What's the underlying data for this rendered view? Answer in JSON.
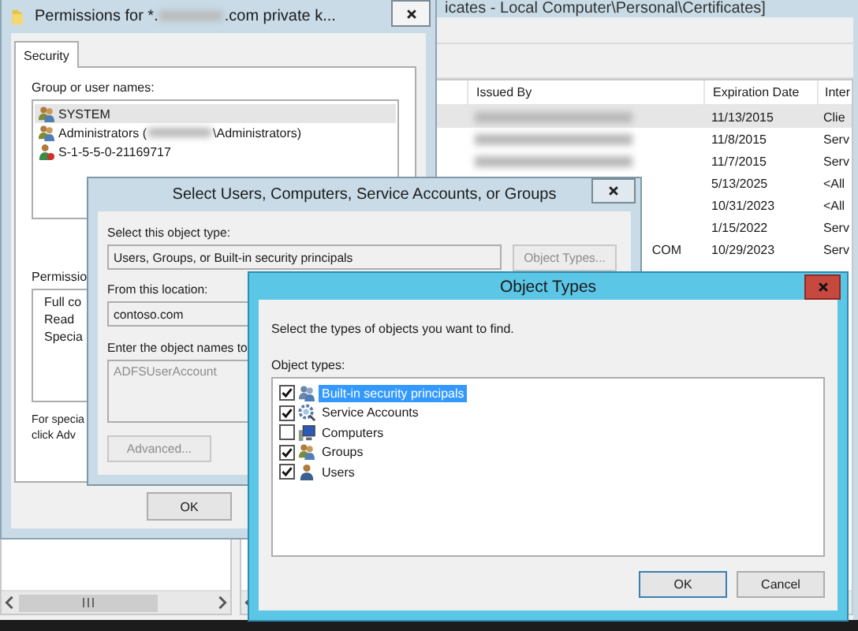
{
  "certificates_window": {
    "title": "icates - Local Computer\\Personal\\Certificates]",
    "columns": [
      "Issued By",
      "Expiration Date",
      "Inter"
    ],
    "rows": [
      {
        "issued_by_redacted": true,
        "expiration_date": "11/13/2015",
        "intended": "Clie",
        "selected": true
      },
      {
        "issued_by_redacted": true,
        "expiration_date": "11/8/2015",
        "intended": "Serv",
        "selected": false
      },
      {
        "issued_by_redacted": true,
        "expiration_date": "11/7/2015",
        "intended": "Serv",
        "selected": false
      },
      {
        "issued_by_redacted": false,
        "expiration_date": "5/13/2025",
        "intended": "<All",
        "selected": false
      },
      {
        "issued_by_redacted": false,
        "expiration_date": "10/31/2023",
        "intended": "<All",
        "selected": false
      },
      {
        "issued_by_redacted": false,
        "expiration_date": "1/15/2022",
        "intended": "Serv",
        "selected": false
      },
      {
        "issued_by_redacted": false,
        "issued_by": "COM",
        "expiration_date": "10/29/2023",
        "intended": "Serv",
        "selected": false
      }
    ]
  },
  "permissions_window": {
    "title_start": "Permissions for *.",
    "title_end": ".com private k...",
    "tabs": [
      {
        "label": "Security",
        "selected": true
      }
    ],
    "users_label": "Group or user names:",
    "users": [
      {
        "kind": "group",
        "name": "SYSTEM",
        "selected": true
      },
      {
        "kind": "group",
        "name": "Administrators (",
        "name_end": "\\Administrators)",
        "selected": false
      },
      {
        "kind": "unknown",
        "name": "S-1-5-5-0-21169717",
        "selected": false
      }
    ],
    "permissions_label": "Permissio",
    "permissions": [
      "Full co",
      "Read",
      "Specia"
    ],
    "note_lines": [
      "For specia",
      "click Adv"
    ],
    "buttons": [
      "OK"
    ]
  },
  "select_dialog": {
    "title": "Select Users, Computers, Service Accounts, or Groups",
    "object_type_label": "Select this object type:",
    "object_type": "Users, Groups, or Built-in security principals",
    "object_types_button": {
      "label": "Object Types...",
      "disabled": true
    },
    "location_label": "From this location:",
    "location": "contoso.com",
    "names_label": "Enter the object names to",
    "names_field": {
      "value": "ADFSUserAccount",
      "disabled": true
    },
    "advanced_button": {
      "label": "Advanced...",
      "disabled": true
    }
  },
  "object_types_dialog": {
    "title": "Object Types",
    "prompt": "Select the types of objects you want to find.",
    "list_label": "Object types:",
    "items": [
      {
        "kind": "builtin",
        "label": "Built-in security principals",
        "checked": true,
        "selected": true
      },
      {
        "kind": "service",
        "label": "Service Accounts",
        "checked": true,
        "selected": false
      },
      {
        "kind": "computer",
        "label": "Computers",
        "checked": false,
        "selected": false
      },
      {
        "kind": "group",
        "label": "Groups",
        "checked": true,
        "selected": false
      },
      {
        "kind": "user",
        "label": "Users",
        "checked": true,
        "selected": false
      }
    ],
    "buttons": [
      "OK",
      "Cancel"
    ]
  }
}
